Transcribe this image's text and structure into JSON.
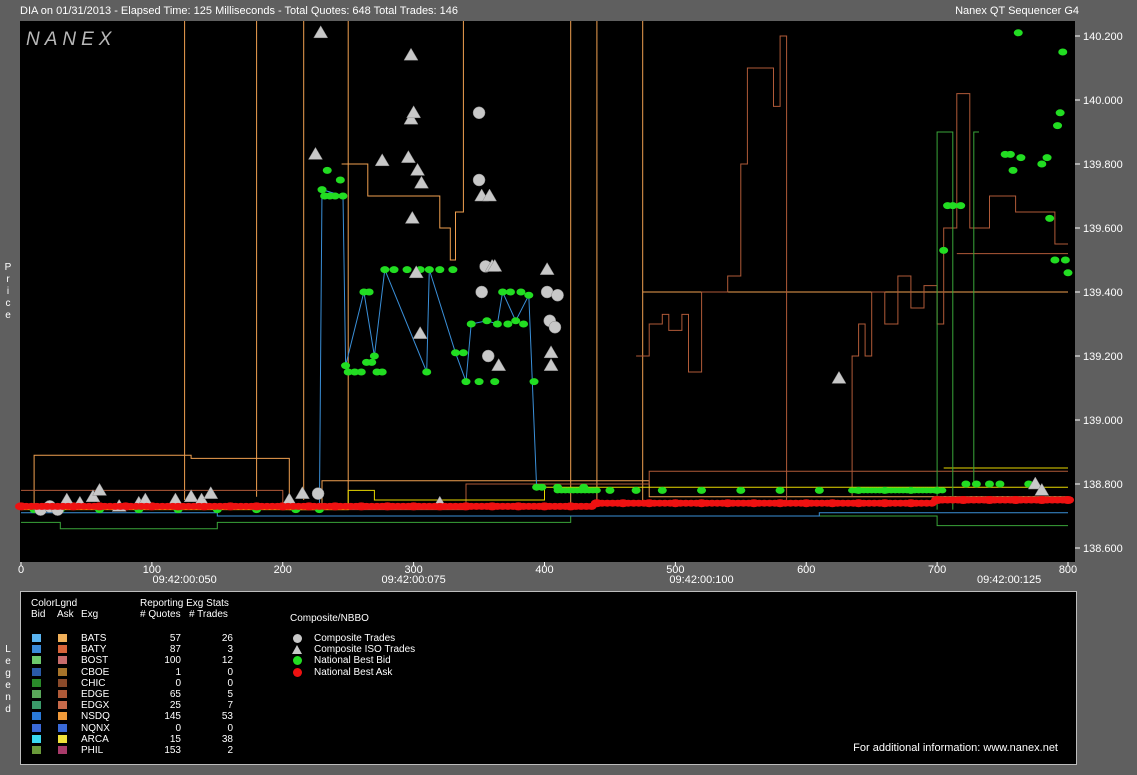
{
  "header": {
    "left": "DIA on 01/31/2013  -  Elapsed Time: 125 Milliseconds  -  Total Quotes: 648  Total Trades: 146",
    "right": "Nanex QT Sequencer G4"
  },
  "logo_text": "NANEX",
  "side_labels": {
    "price": "Price",
    "legend": "Legend"
  },
  "colors": {
    "background": "#5f5f5f",
    "plot_bg": "#000000",
    "bid_dot": "#22dd22",
    "ask_dot": "#ee1111",
    "trade_marker": "#c8c8c8",
    "bid_line": "#3a8fd8",
    "ask_line_orange": "#f0a050",
    "ask_line_brown": "#b05a38",
    "ask_line_yellow": "#e8d800",
    "bid_line_green": "#3aa53a"
  },
  "chart_data": {
    "type": "scatter",
    "title": "DIA on 01/31/2013",
    "xlabel": "",
    "ylabel": "Price",
    "xlim": [
      0,
      800
    ],
    "ylim": [
      138.55,
      140.25
    ],
    "x_ticks": [
      0,
      100,
      200,
      300,
      400,
      500,
      600,
      700,
      800
    ],
    "time_ticks": [
      {
        "x": 125,
        "label": "09:42:00:050"
      },
      {
        "x": 300,
        "label": "09:42:00:075"
      },
      {
        "x": 520,
        "label": "09:42:00:100"
      },
      {
        "x": 755,
        "label": "09:42:00:125"
      }
    ],
    "y_ticks": [
      138.6,
      138.8,
      139.0,
      139.2,
      139.4,
      139.6,
      139.8,
      140.0,
      140.2
    ],
    "y_tick_labels": [
      "138.600",
      "138.800",
      "139.000",
      "139.200",
      "139.400",
      "139.600",
      "139.800",
      "140.000",
      "140.200"
    ],
    "series": [
      {
        "name": "National Best Bid",
        "color": "#22dd22",
        "points": [
          [
            10,
            138.72
          ],
          [
            30,
            138.72
          ],
          [
            60,
            138.72
          ],
          [
            90,
            138.72
          ],
          [
            120,
            138.72
          ],
          [
            150,
            138.72
          ],
          [
            180,
            138.72
          ],
          [
            210,
            138.72
          ],
          [
            228,
            138.72
          ],
          [
            230,
            139.72
          ],
          [
            232,
            139.7
          ],
          [
            234,
            139.78
          ],
          [
            236,
            139.7
          ],
          [
            240,
            139.7
          ],
          [
            244,
            139.75
          ],
          [
            246,
            139.7
          ],
          [
            248,
            139.17
          ],
          [
            250,
            139.15
          ],
          [
            255,
            139.15
          ],
          [
            260,
            139.15
          ],
          [
            262,
            139.4
          ],
          [
            264,
            139.18
          ],
          [
            266,
            139.4
          ],
          [
            268,
            139.18
          ],
          [
            270,
            139.2
          ],
          [
            272,
            139.15
          ],
          [
            276,
            139.15
          ],
          [
            278,
            139.47
          ],
          [
            285,
            139.47
          ],
          [
            295,
            139.47
          ],
          [
            305,
            139.47
          ],
          [
            310,
            139.15
          ],
          [
            312,
            139.47
          ],
          [
            320,
            139.47
          ],
          [
            330,
            139.47
          ],
          [
            332,
            139.21
          ],
          [
            338,
            139.21
          ],
          [
            340,
            139.12
          ],
          [
            344,
            139.3
          ],
          [
            350,
            139.12
          ],
          [
            356,
            139.31
          ],
          [
            362,
            139.12
          ],
          [
            364,
            139.3
          ],
          [
            368,
            139.4
          ],
          [
            372,
            139.3
          ],
          [
            374,
            139.4
          ],
          [
            378,
            139.31
          ],
          [
            382,
            139.4
          ],
          [
            384,
            139.3
          ],
          [
            388,
            139.39
          ],
          [
            392,
            139.12
          ],
          [
            394,
            138.79
          ],
          [
            398,
            138.79
          ],
          [
            410,
            138.79
          ],
          [
            430,
            138.79
          ],
          [
            450,
            138.78
          ],
          [
            470,
            138.78
          ],
          [
            490,
            138.78
          ],
          [
            520,
            138.78
          ],
          [
            550,
            138.78
          ],
          [
            580,
            138.78
          ],
          [
            610,
            138.78
          ],
          [
            640,
            138.78
          ],
          [
            660,
            138.78
          ],
          [
            680,
            138.78
          ],
          [
            700,
            138.78
          ],
          [
            705,
            139.53
          ],
          [
            708,
            139.67
          ],
          [
            712,
            139.67
          ],
          [
            718,
            139.67
          ],
          [
            722,
            138.8
          ],
          [
            730,
            138.8
          ],
          [
            740,
            138.8
          ],
          [
            748,
            138.8
          ],
          [
            752,
            139.83
          ],
          [
            756,
            139.83
          ],
          [
            758,
            139.78
          ],
          [
            762,
            140.21
          ],
          [
            764,
            139.82
          ],
          [
            770,
            138.8
          ],
          [
            780,
            139.8
          ],
          [
            784,
            139.82
          ],
          [
            786,
            139.63
          ],
          [
            790,
            139.5
          ],
          [
            792,
            139.92
          ],
          [
            794,
            139.96
          ],
          [
            796,
            140.15
          ],
          [
            798,
            139.5
          ],
          [
            800,
            139.46
          ]
        ]
      },
      {
        "name": "National Best Ask",
        "color": "#ee1111",
        "points": [
          [
            0,
            138.73
          ],
          [
            20,
            138.73
          ],
          [
            40,
            138.73
          ],
          [
            60,
            138.73
          ],
          [
            80,
            138.73
          ],
          [
            100,
            138.73
          ],
          [
            120,
            138.73
          ],
          [
            140,
            138.73
          ],
          [
            160,
            138.73
          ],
          [
            180,
            138.73
          ],
          [
            200,
            138.73
          ],
          [
            220,
            138.73
          ],
          [
            240,
            138.73
          ],
          [
            260,
            138.73
          ],
          [
            280,
            138.73
          ],
          [
            300,
            138.73
          ],
          [
            320,
            138.73
          ],
          [
            340,
            138.73
          ],
          [
            360,
            138.73
          ],
          [
            380,
            138.73
          ],
          [
            400,
            138.73
          ],
          [
            420,
            138.73
          ],
          [
            440,
            138.74
          ],
          [
            460,
            138.74
          ],
          [
            480,
            138.74
          ],
          [
            500,
            138.74
          ],
          [
            520,
            138.74
          ],
          [
            540,
            138.74
          ],
          [
            560,
            138.74
          ],
          [
            580,
            138.74
          ],
          [
            600,
            138.74
          ],
          [
            620,
            138.74
          ],
          [
            640,
            138.74
          ],
          [
            660,
            138.74
          ],
          [
            680,
            138.74
          ],
          [
            700,
            138.75
          ],
          [
            720,
            138.75
          ],
          [
            740,
            138.75
          ],
          [
            760,
            138.75
          ],
          [
            780,
            138.75
          ],
          [
            800,
            138.75
          ]
        ]
      },
      {
        "name": "Composite Trades",
        "color": "#c8c8c8",
        "points": [
          [
            15,
            138.72
          ],
          [
            22,
            138.73
          ],
          [
            28,
            138.72
          ],
          [
            227,
            138.77
          ],
          [
            350,
            139.96
          ],
          [
            350,
            139.75
          ],
          [
            352,
            139.4
          ],
          [
            355,
            139.48
          ],
          [
            357,
            139.2
          ],
          [
            402,
            139.4
          ],
          [
            404,
            139.31
          ],
          [
            408,
            139.29
          ],
          [
            410,
            139.39
          ]
        ]
      },
      {
        "name": "Composite ISO Trades",
        "color": "#c8c8c8",
        "points": [
          [
            35,
            138.75
          ],
          [
            45,
            138.74
          ],
          [
            55,
            138.76
          ],
          [
            60,
            138.78
          ],
          [
            75,
            138.73
          ],
          [
            90,
            138.74
          ],
          [
            95,
            138.75
          ],
          [
            118,
            138.75
          ],
          [
            130,
            138.76
          ],
          [
            138,
            138.75
          ],
          [
            145,
            138.77
          ],
          [
            205,
            138.75
          ],
          [
            215,
            138.77
          ],
          [
            225,
            139.83
          ],
          [
            229,
            140.21
          ],
          [
            276,
            139.81
          ],
          [
            298,
            140.14
          ],
          [
            298,
            139.94
          ],
          [
            300,
            139.96
          ],
          [
            299,
            139.63
          ],
          [
            296,
            139.82
          ],
          [
            303,
            139.78
          ],
          [
            306,
            139.74
          ],
          [
            302,
            139.46
          ],
          [
            305,
            139.27
          ],
          [
            320,
            138.74
          ],
          [
            352,
            139.7
          ],
          [
            358,
            139.7
          ],
          [
            360,
            139.48
          ],
          [
            362,
            139.48
          ],
          [
            365,
            139.17
          ],
          [
            402,
            139.47
          ],
          [
            405,
            139.21
          ],
          [
            405,
            139.17
          ],
          [
            625,
            139.13
          ],
          [
            775,
            138.8
          ],
          [
            780,
            138.78
          ]
        ]
      }
    ]
  },
  "legend": {
    "header": {
      "colorlgnd": "ColorLgnd",
      "bid": "Bid",
      "ask": "Ask",
      "exg": "Exg",
      "stats": "Reporting Exg Stats",
      "quotes": "# Quotes",
      "trades": "# Trades",
      "composite": "Composite/NBBO"
    },
    "rows": [
      {
        "exg": "BATS",
        "quotes": "57",
        "trades": "26",
        "bid": "#5ab4f0",
        "ask": "#f0b05a"
      },
      {
        "exg": "BATY",
        "quotes": "87",
        "trades": "3",
        "bid": "#3a8ad8",
        "ask": "#d8643a"
      },
      {
        "exg": "BOST",
        "quotes": "100",
        "trades": "12",
        "bid": "#6cc86c",
        "ask": "#c86c6c"
      },
      {
        "exg": "CBOE",
        "quotes": "1",
        "trades": "0",
        "bid": "#2a5aa8",
        "ask": "#a8742a"
      },
      {
        "exg": "CHIC",
        "quotes": "0",
        "trades": "0",
        "bid": "#2a8a2a",
        "ask": "#8a4a2a"
      },
      {
        "exg": "EDGE",
        "quotes": "65",
        "trades": "5",
        "bid": "#5aa85a",
        "ask": "#b05a38"
      },
      {
        "exg": "EDGX",
        "quotes": "25",
        "trades": "7",
        "bid": "#3a9a6a",
        "ask": "#c86a4a"
      },
      {
        "exg": "NSDQ",
        "quotes": "145",
        "trades": "53",
        "bid": "#2a7ad8",
        "ask": "#f09a3a"
      },
      {
        "exg": "NQNX",
        "quotes": "0",
        "trades": "0",
        "bid": "#3a6ad8",
        "ask": "#3a6ad8"
      },
      {
        "exg": "ARCA",
        "quotes": "15",
        "trades": "38",
        "bid": "#3ad8f0",
        "ask": "#f0e03a"
      },
      {
        "exg": "PHIL",
        "quotes": "153",
        "trades": "2",
        "bid": "#6a9a3a",
        "ask": "#a83a6a"
      }
    ],
    "composite_items": [
      {
        "label": "Composite Trades",
        "icon": "circle-icon",
        "color": "#c8c8c8"
      },
      {
        "label": "Composite ISO Trades",
        "icon": "triangle-icon",
        "color": "#c8c8c8"
      },
      {
        "label": "National Best Bid",
        "icon": "dot-icon",
        "color": "#22dd22"
      },
      {
        "label": "National Best Ask",
        "icon": "dot-icon",
        "color": "#ee1111"
      }
    ],
    "footer": "For additional information: www.nanex.net"
  }
}
